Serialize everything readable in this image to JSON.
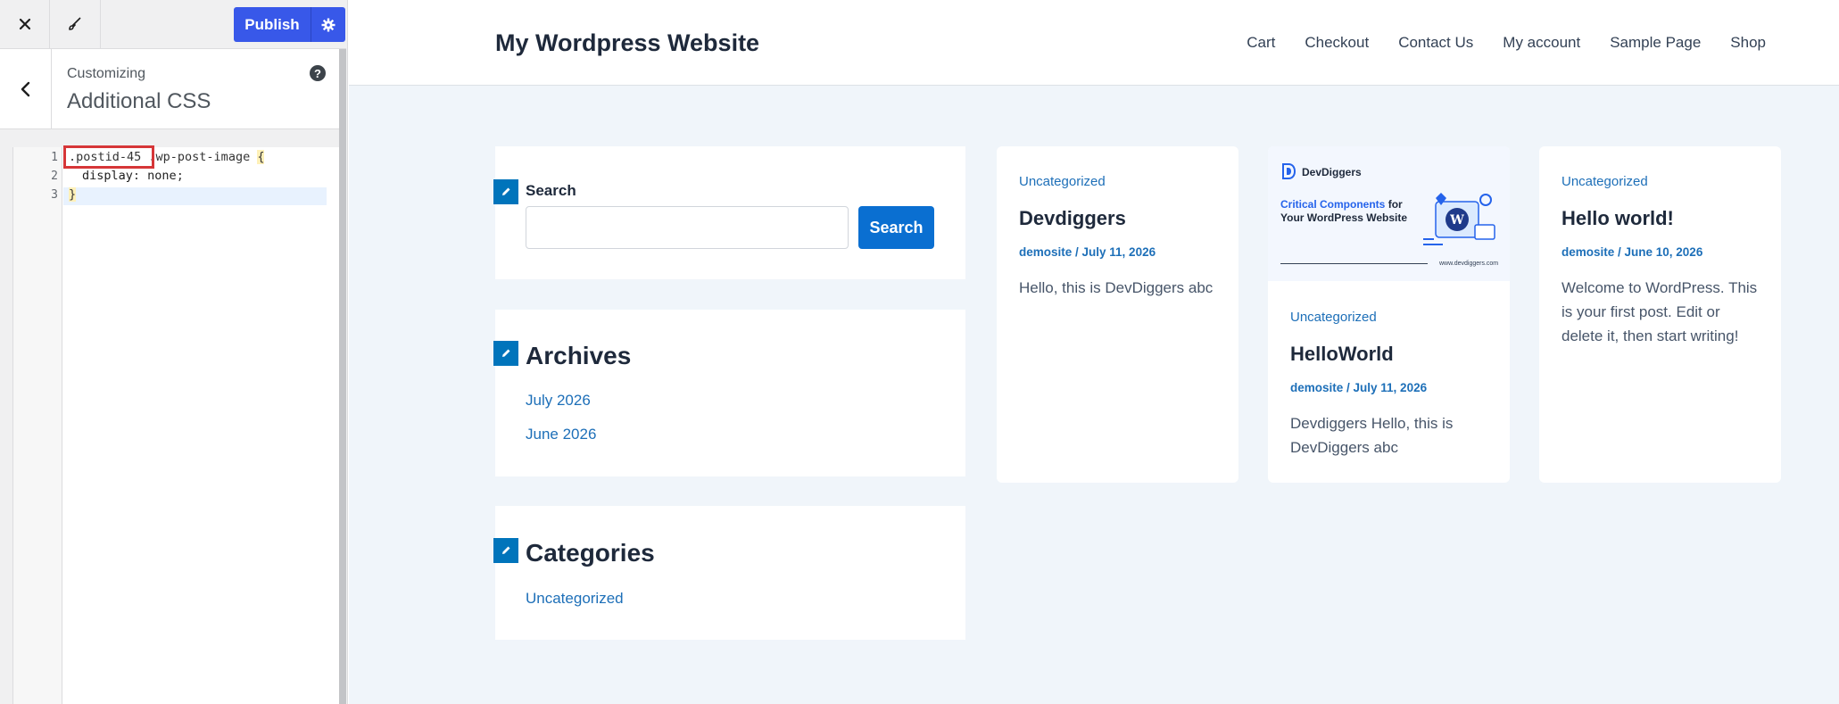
{
  "customizer": {
    "publish_label": "Publish",
    "section": {
      "crumb": "Customizing",
      "title": "Additional CSS",
      "help": "?"
    },
    "editor": {
      "line_numbers": [
        "1",
        "2",
        "3"
      ],
      "selector_highlighted": ".postid-45",
      "selector_rest": " .wp-post-image ",
      "open_brace": "{",
      "prop": "display",
      "value": "none",
      "close_brace": "}"
    }
  },
  "site": {
    "title": "My Wordpress Website",
    "nav": [
      "Cart",
      "Checkout",
      "Contact Us",
      "My account",
      "Sample Page",
      "Shop"
    ],
    "search_widget": {
      "label": "Search",
      "button": "Search",
      "value": ""
    },
    "archives": {
      "title": "Archives",
      "links": [
        "July 2026",
        "June 2026"
      ]
    },
    "categories": {
      "title": "Categories",
      "links": [
        "Uncategorized"
      ]
    },
    "posts": [
      {
        "category": "Uncategorized",
        "title": "Devdiggers",
        "meta": "demosite / July 11, 2026",
        "excerpt": "Hello, this is DevDiggers abc"
      },
      {
        "category": "Uncategorized",
        "title": "HelloWorld",
        "meta": "demosite / July 11, 2026",
        "excerpt": "Devdiggers Hello, this is DevDiggers abc",
        "thumbnail": {
          "brand": "DevDiggers",
          "headline_accent": "Critical Components",
          "headline_rest": " for Your WordPress Website",
          "url": "www.devdiggers.com"
        }
      },
      {
        "category": "Uncategorized",
        "title": "Hello world!",
        "meta": "demosite / June 10, 2026",
        "excerpt": "Welcome to WordPress. This is your first post. Edit or delete it, then start writing!"
      }
    ]
  },
  "colors": {
    "publish": "#3858e9",
    "link": "#1d6fb8",
    "search_button": "#0a6fd1",
    "edit_pencil": "#0074bb",
    "preview_bg": "#f0f5fa",
    "highlight_box": "#d63638"
  },
  "icons": [
    "close-icon",
    "brush-icon",
    "gear-icon",
    "chevron-left-icon",
    "help-icon",
    "pencil-icon"
  ]
}
